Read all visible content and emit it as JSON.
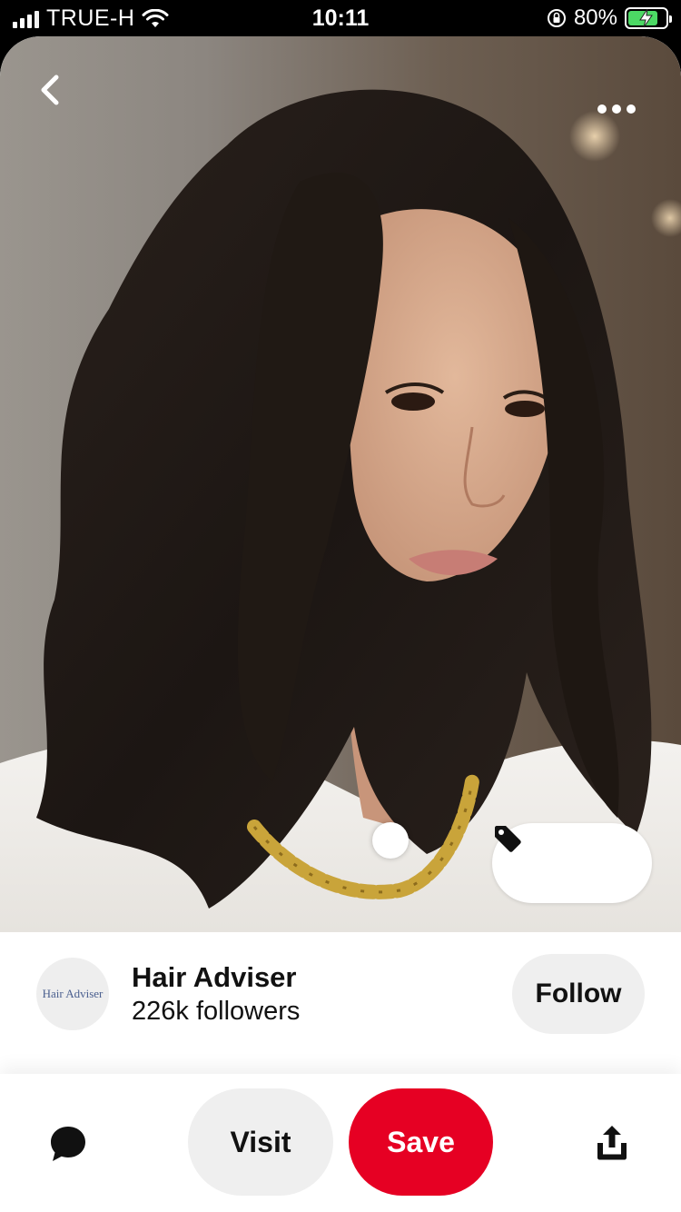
{
  "status_bar": {
    "carrier": "TRUE-H",
    "time": "10:11",
    "battery_percent": "80%",
    "battery_level": 0.8,
    "icons": [
      "signal-icon",
      "wifi-icon",
      "orientation-lock-icon",
      "battery-icon",
      "charging-bolt-icon"
    ]
  },
  "pin": {
    "image_description_icon": "portrait-photo",
    "nav": {
      "back_icon": "chevron-left-icon",
      "more_icon": "ellipsis-icon"
    },
    "tag_icon": "price-tag-icon"
  },
  "creator": {
    "avatar_text": "Hair Adviser",
    "name": "Hair Adviser",
    "followers": "226k followers",
    "follow_label": "Follow"
  },
  "actions": {
    "visit_label": "Visit",
    "save_label": "Save",
    "comment_icon": "comment-icon",
    "share_icon": "share-icon"
  },
  "colors": {
    "save": "#e60023",
    "button_gray": "#efefef",
    "text": "#111111"
  }
}
